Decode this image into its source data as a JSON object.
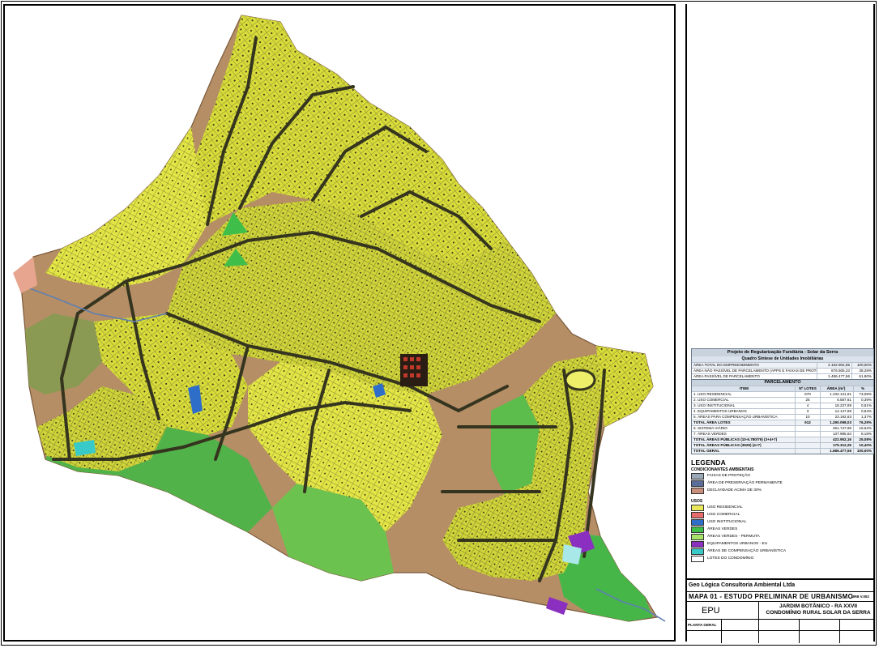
{
  "summary": {
    "title": "Projeto de Regularização Fundiária - Solar da Serra",
    "subtitle": "Quadro Síntese de Unidades Imobiliárias",
    "rows": [
      {
        "item": "ÁREA TOTAL DO EMPREENDIMENTO",
        "area": "2.162.902,85",
        "pct": "100,00%"
      },
      {
        "item": "ÁREA NÃO PASSÍVEL DE PARCELAMENTO (APPS E FAIXAS DE PROTEÇÃO)",
        "area": "676.505,23",
        "pct": "38,28%"
      },
      {
        "item": "ÁREA PASSÍVEL DE PARCELAMENTO",
        "area": "1.486.477,56",
        "pct": "61,80%"
      }
    ]
  },
  "parcelamento": {
    "title": "PARCELAMENTO",
    "headers": [
      "ITEM",
      "Nº LOTES",
      "ÁREA (m²)",
      "%"
    ],
    "rows": [
      {
        "item": "1. USO RESIDENCIAL",
        "lotes": "870",
        "area": "1.232.131,91",
        "pct": "73,08%",
        "total": false
      },
      {
        "item": "2. USO COMERCIAL",
        "lotes": "25",
        "area": "6.587,61",
        "pct": "0,39%",
        "total": false
      },
      {
        "item": "3. USO INSTITUCIONAL",
        "lotes": "4",
        "area": "18.237,89",
        "pct": "0,61%",
        "total": false
      },
      {
        "item": "4. EQUIPAMENTOS URBANOS",
        "lotes": "3",
        "area": "14.147,99",
        "pct": "0,84%",
        "total": false
      },
      {
        "item": "5. ÁREAS PARA COMPENSAÇÃO URBANÍSTICA",
        "lotes": "10",
        "area": "23.192,63",
        "pct": "1,37%",
        "total": false
      },
      {
        "item": "TOTAL ÁREA LOTES",
        "lotes": "912",
        "area": "1.290.098,03",
        "pct": "76,29%",
        "total": true
      },
      {
        "item": "6. SISTEMA VIÁRIO",
        "lotes": "",
        "area": "261.747,99",
        "pct": "15,52%",
        "total": false
      },
      {
        "item": "7. ÁREAS VERDES",
        "lotes": "",
        "area": "137.985,63",
        "pct": "8,18%",
        "total": false
      },
      {
        "item": "TOTAL ÁREAS PÚBLICAS (10-6.780/79) (3+4+7)",
        "lotes": "",
        "area": "422.952,16",
        "pct": "25,08%",
        "total": true
      },
      {
        "item": "TOTAL ÁREAS PÚBLICAS (3929) (4+7)",
        "lotes": "",
        "area": "175.312,25",
        "pct": "10,40%",
        "total": true
      },
      {
        "item": "TOTAL GERAL",
        "lotes": "",
        "area": "1.686.477,56",
        "pct": "100,00%",
        "total": true
      }
    ]
  },
  "legend": {
    "title": "LEGENDA",
    "env_title": "CONDICIONANTES AMBIENTAIS",
    "env_items": [
      {
        "label": "FAIXAS DE PROTEÇÃO",
        "color": "#9aa8b8"
      },
      {
        "label": "ÁREA DE PRESERVAÇÃO PERMANENTE",
        "color": "#5a6e9c"
      },
      {
        "label": "DECLIVIDADE ACIMA DE 30%",
        "color": "#c98f7d"
      }
    ],
    "uses_title": "USOS",
    "use_items": [
      {
        "label": "USO RESIDENCIAL",
        "color": "#e9e85a"
      },
      {
        "label": "USO COMERCIAL",
        "color": "#e86b6b"
      },
      {
        "label": "USO INSTITUCIONAL",
        "color": "#2e6ec9"
      },
      {
        "label": "ÁREAS VERDES",
        "color": "#3fbf4a"
      },
      {
        "label": "ÁREAS VERDES - PERMUTA",
        "color": "#a6e36a"
      },
      {
        "label": "EQUIPAMENTOS URBANOS - EU",
        "color": "#8a2fc0"
      },
      {
        "label": "ÁREAS DE COMPENSAÇÃO URBANÍSTICA",
        "color": "#38c9c9"
      },
      {
        "label": "LOTES DO CONDOMÍNIO",
        "color": "#ffffff"
      }
    ]
  },
  "titleblock": {
    "company": "Geo Lógica Consultoria Ambiental Ltda",
    "mapa": "MAPA 01 - ESTUDO PRELIMINAR DE URBANISMO",
    "mapa_code": "URB V.002",
    "epu": "EPU",
    "project_line1": "JARDIM BOTÂNICO - RA XXVII",
    "project_line2": "CONDOMÍNIO RURAL SOLAR DA SERRA",
    "planta": "PLANTA GERAL"
  },
  "map": {
    "colors": {
      "lots": "#d8dc3a",
      "lots_light": "#eef06a",
      "green": "#4fb845",
      "slope": "#b9906c",
      "roads": "#3a3a2a",
      "water": "#5f7fb0"
    }
  }
}
